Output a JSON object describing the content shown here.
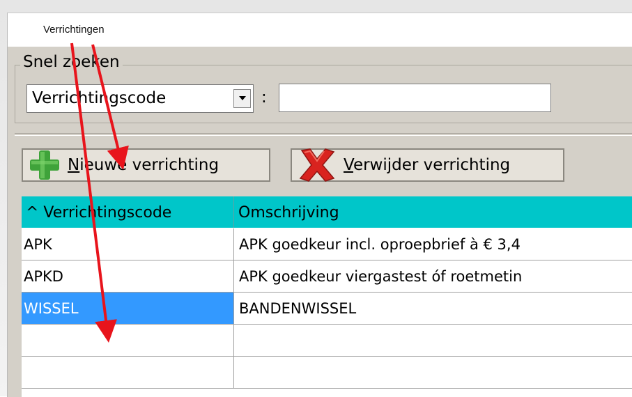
{
  "window": {
    "title": "Verrichtingen"
  },
  "quick_search": {
    "legend": "Snel zoeken",
    "field_select": {
      "selected": "Verrichtingscode"
    },
    "separator": ":",
    "search_value": ""
  },
  "toolbar": {
    "add_button": {
      "mnemonic": "N",
      "rest": "ieuwe verrichting",
      "icon": "green-plus-icon"
    },
    "delete_button": {
      "mnemonic": "V",
      "rest": "erwijder verrichting",
      "icon": "red-x-icon"
    }
  },
  "grid": {
    "columns": [
      "^ Verrichtingscode",
      "Omschrijving"
    ],
    "rows": [
      {
        "code": "APK",
        "description": "APK goedkeur incl. oproepbrief à € 3,4"
      },
      {
        "code": "APKD",
        "description": "APK goedkeur viergastest óf roetmetin"
      },
      {
        "code": "WISSEL",
        "description": "BANDENWISSEL",
        "selected": true
      },
      {
        "code": "",
        "description": ""
      },
      {
        "code": "",
        "description": ""
      }
    ]
  },
  "colors": {
    "header_bg": "#00c6c9",
    "selection_bg": "#3399ff",
    "panel_bg": "#d4d0c8",
    "arrow": "#e8141c"
  }
}
